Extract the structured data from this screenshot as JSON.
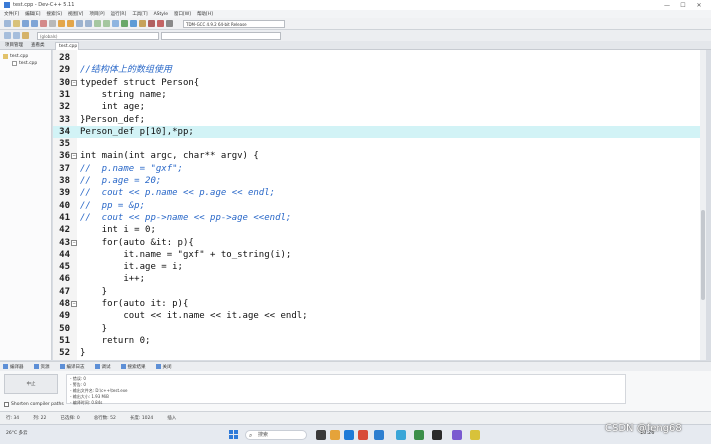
{
  "window": {
    "title": "test.cpp - Dev-C++ 5.11"
  },
  "menubar": {
    "items": [
      "文件[F]",
      "编辑[E]",
      "搜索[S]",
      "视图[V]",
      "项目[P]",
      "运行[R]",
      "工具[T]",
      "AStyle",
      "窗口[W]",
      "帮助[H]"
    ]
  },
  "toolbar": {
    "compiler": "TDM-GCC 4.9.2 64-bit Release"
  },
  "toolbar2": {
    "combo1": "(globals)"
  },
  "panels": {
    "project_tab": "项目管理",
    "class_tab": "查看类"
  },
  "editor": {
    "file_tab": "test.cpp"
  },
  "tree": {
    "root": "test.cpp",
    "child": "test.cpp"
  },
  "code": {
    "lines": [
      {
        "num": "28",
        "text": ""
      },
      {
        "num": "29",
        "text": "//结构体上的数组使用",
        "comment": true
      },
      {
        "num": "30",
        "text": "typedef struct Person{",
        "fold": true
      },
      {
        "num": "31",
        "text": "    string name;"
      },
      {
        "num": "32",
        "text": "    int age;"
      },
      {
        "num": "33",
        "text": "}Person_def;"
      },
      {
        "num": "34",
        "text": "Person_def p[10],*pp;",
        "highlight": true
      },
      {
        "num": "35",
        "text": ""
      },
      {
        "num": "36",
        "text": "int main(int argc, char** argv) {",
        "fold": true
      },
      {
        "num": "37",
        "text": "//  p.name = \"gxf\";",
        "comment": true
      },
      {
        "num": "38",
        "text": "//  p.age = 20;",
        "comment": true
      },
      {
        "num": "39",
        "text": "//  cout << p.name << p.age << endl;",
        "comment": true
      },
      {
        "num": "40",
        "text": "//  pp = &p;",
        "comment": true
      },
      {
        "num": "41",
        "text": "//  cout << pp->name << pp->age <<endl;",
        "comment": true
      },
      {
        "num": "42",
        "text": "    int i = 0;"
      },
      {
        "num": "43",
        "text": "    for(auto &it: p){",
        "fold": true
      },
      {
        "num": "44",
        "text": "        it.name = \"gxf\" + to_string(i);"
      },
      {
        "num": "45",
        "text": "        it.age = i;"
      },
      {
        "num": "46",
        "text": "        i++;"
      },
      {
        "num": "47",
        "text": "    }"
      },
      {
        "num": "48",
        "text": "    for(auto it: p){",
        "fold": true
      },
      {
        "num": "49",
        "text": "        cout << it.name << it.age << endl;"
      },
      {
        "num": "50",
        "text": "    }"
      },
      {
        "num": "51",
        "text": "    return 0;"
      },
      {
        "num": "52",
        "text": "}"
      }
    ]
  },
  "bottom_tabs": [
    "编译器",
    "资源",
    "编译日志",
    "调试",
    "搜索结果",
    "关闭"
  ],
  "output": {
    "compile_button": "中止",
    "lines": [
      "- 错误: 0",
      "- 警告: 0",
      "- 输出文件名: D:\\c++\\test.exe",
      "- 输出大小: 1.93 MiB",
      "- 编译时间: 0.84s"
    ],
    "abort_label": "Shorten compiler paths"
  },
  "statusbar": {
    "row": "行: 34",
    "col": "列: 22",
    "sel": "已选择: 0",
    "total": "总行数: 52",
    "len": "长度: 1024",
    "mode": "插入"
  },
  "taskbar": {
    "weather": "26°C 多云",
    "search": "搜索",
    "time": "10:26"
  },
  "watermark": "CSDN @feng68"
}
